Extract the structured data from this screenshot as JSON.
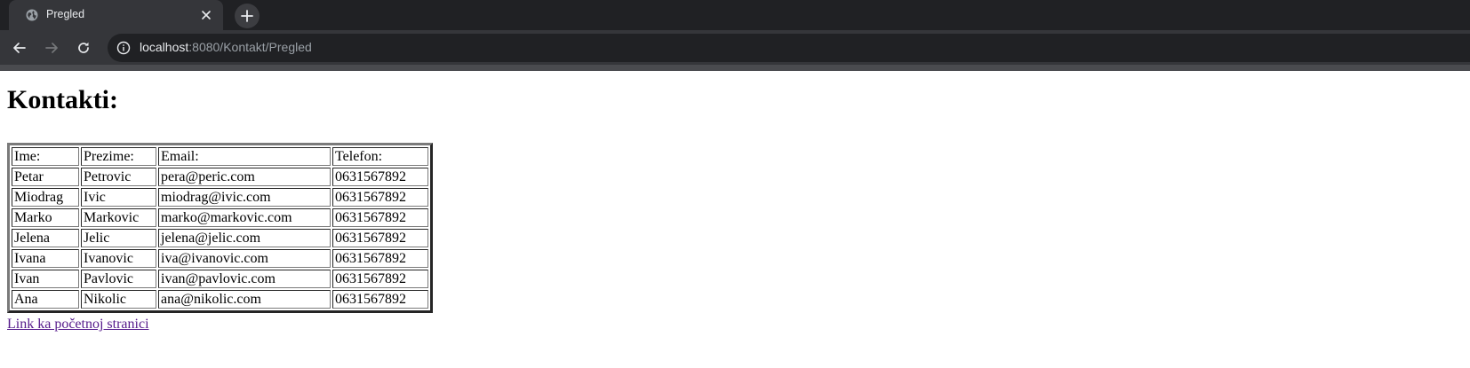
{
  "browser": {
    "tab": {
      "title": "Pregled",
      "favicon": "globe-icon"
    },
    "address_bar": {
      "host": "localhost",
      "path": ":8080/Kontakt/Pregled"
    },
    "colors": {
      "tabstrip": "#202124",
      "toolbar": "#35363a",
      "text": "#e8eaed"
    }
  },
  "page": {
    "heading": "Kontakti:",
    "table": {
      "headers": [
        "Ime:",
        "Prezime:",
        "Email:",
        "Telefon:"
      ],
      "rows": [
        [
          "Petar",
          "Petrovic",
          "pera@peric.com",
          "0631567892"
        ],
        [
          "Miodrag",
          "Ivic",
          "miodrag@ivic.com",
          "0631567892"
        ],
        [
          "Marko",
          "Markovic",
          "marko@markovic.com",
          "0631567892"
        ],
        [
          "Jelena",
          "Jelic",
          "jelena@jelic.com",
          "0631567892"
        ],
        [
          "Ivana",
          "Ivanovic",
          "iva@ivanovic.com",
          "0631567892"
        ],
        [
          "Ivan",
          "Pavlovic",
          "ivan@pavlovic.com",
          "0631567892"
        ],
        [
          "Ana",
          "Nikolic",
          "ana@nikolic.com",
          "0631567892"
        ]
      ]
    },
    "link": {
      "label": "Link ka početnoj stranici",
      "color": "#551a8b"
    }
  }
}
